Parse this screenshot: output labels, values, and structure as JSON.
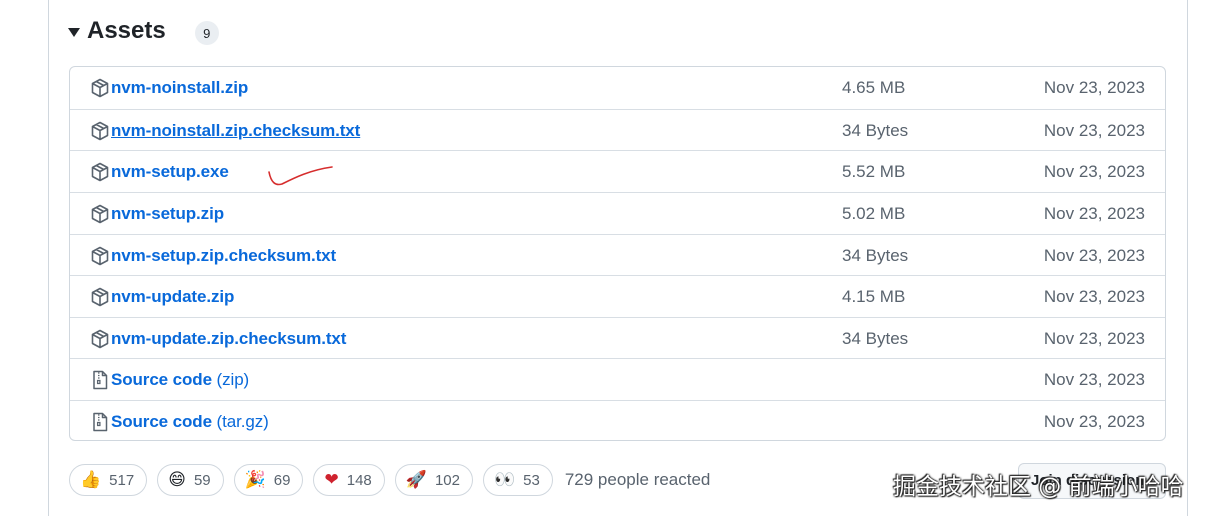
{
  "assets_section": {
    "title": "Assets",
    "count": "9"
  },
  "assets": [
    {
      "name": "nvm-noinstall.zip",
      "suffix": "",
      "size": "4.65 MB",
      "date": "Nov 23, 2023",
      "icon": "package-icon"
    },
    {
      "name": "nvm-noinstall.zip.checksum.txt",
      "suffix": "",
      "size": "34 Bytes",
      "date": "Nov 23, 2023",
      "icon": "package-icon"
    },
    {
      "name": "nvm-setup.exe",
      "suffix": "",
      "size": "5.52 MB",
      "date": "Nov 23, 2023",
      "icon": "package-icon"
    },
    {
      "name": "nvm-setup.zip",
      "suffix": "",
      "size": "5.02 MB",
      "date": "Nov 23, 2023",
      "icon": "package-icon"
    },
    {
      "name": "nvm-setup.zip.checksum.txt",
      "suffix": "",
      "size": "34 Bytes",
      "date": "Nov 23, 2023",
      "icon": "package-icon"
    },
    {
      "name": "nvm-update.zip",
      "suffix": "",
      "size": "4.15 MB",
      "date": "Nov 23, 2023",
      "icon": "package-icon"
    },
    {
      "name": "nvm-update.zip.checksum.txt",
      "suffix": "",
      "size": "34 Bytes",
      "date": "Nov 23, 2023",
      "icon": "package-icon"
    },
    {
      "name": "Source code",
      "suffix": " (zip)",
      "size": "",
      "date": "Nov 23, 2023",
      "icon": "file-zip-icon"
    },
    {
      "name": "Source code",
      "suffix": " (tar.gz)",
      "size": "",
      "date": "Nov 23, 2023",
      "icon": "file-zip-icon"
    }
  ],
  "reactions": [
    {
      "emoji": "👍",
      "count": "517",
      "icon": "thumbs-up-icon"
    },
    {
      "emoji": "😄",
      "count": "59",
      "icon": "laugh-icon"
    },
    {
      "emoji": "🎉",
      "count": "69",
      "icon": "hooray-icon"
    },
    {
      "emoji": "❤",
      "count": "148",
      "icon": "heart-icon"
    },
    {
      "emoji": "🚀",
      "count": "102",
      "icon": "rocket-icon"
    },
    {
      "emoji": "👀",
      "count": "53",
      "icon": "eyes-icon"
    }
  ],
  "reactions_summary": "729 people reacted",
  "join_discussion_label": "Join discussion",
  "watermark": "掘金技术社区 @ 前端小哈哈",
  "colors": {
    "link": "#0969da",
    "muted": "#59636e",
    "border": "#d0d7de",
    "annotation": "#d62d2d"
  }
}
